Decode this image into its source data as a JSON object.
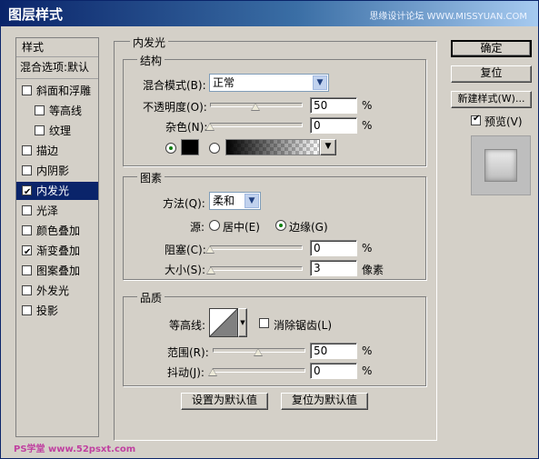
{
  "window": {
    "title": "图层样式",
    "watermark": "思缘设计论坛 WWW.MISSYUAN.COM"
  },
  "sidebar": {
    "header": "样式",
    "blend": "混合选项:默认",
    "items": [
      {
        "label": "斜面和浮雕",
        "checked": false
      },
      {
        "label": "等高线",
        "checked": false
      },
      {
        "label": "纹理",
        "checked": false
      },
      {
        "label": "描边",
        "checked": false
      },
      {
        "label": "内阴影",
        "checked": false
      },
      {
        "label": "内发光",
        "checked": true
      },
      {
        "label": "光泽",
        "checked": false
      },
      {
        "label": "颜色叠加",
        "checked": false
      },
      {
        "label": "渐变叠加",
        "checked": true
      },
      {
        "label": "图案叠加",
        "checked": false
      },
      {
        "label": "外发光",
        "checked": false
      },
      {
        "label": "投影",
        "checked": false
      }
    ]
  },
  "panel": {
    "title": "内发光",
    "structure": {
      "title": "结构",
      "blend_mode_label": "混合模式(B):",
      "blend_mode_value": "正常",
      "opacity_label": "不透明度(O):",
      "opacity_value": "50",
      "opacity_unit": "%",
      "opacity_fraction": 0.5,
      "noise_label": "杂色(N):",
      "noise_value": "0",
      "noise_unit": "%",
      "noise_fraction": 0
    },
    "elements": {
      "title": "图素",
      "method_label": "方法(Q):",
      "method_value": "柔和",
      "source_label": "源:",
      "source_center": "居中(E)",
      "source_edge": "边缘(G)",
      "choke_label": "阻塞(C):",
      "choke_value": "0",
      "choke_unit": "%",
      "choke_fraction": 0,
      "size_label": "大小(S):",
      "size_value": "3",
      "size_unit": "像素",
      "size_fraction": 0.012
    },
    "quality": {
      "title": "品质",
      "contour_label": "等高线:",
      "antialias_label": "消除锯齿(L)",
      "range_label": "范围(R):",
      "range_value": "50",
      "range_unit": "%",
      "range_fraction": 0.5,
      "jitter_label": "抖动(J):",
      "jitter_value": "0",
      "jitter_unit": "%",
      "jitter_fraction": 0
    },
    "buttons": {
      "make_default": "设置为默认值",
      "reset_default": "复位为默认值"
    }
  },
  "actions": {
    "ok": "确定",
    "reset": "复位",
    "new_style": "新建样式(W)...",
    "preview_label": "预览(V)"
  },
  "footer": "PS学堂 www.52psxt.com",
  "colors": {
    "selection": "#0a246a",
    "glow_color": "#000000"
  }
}
